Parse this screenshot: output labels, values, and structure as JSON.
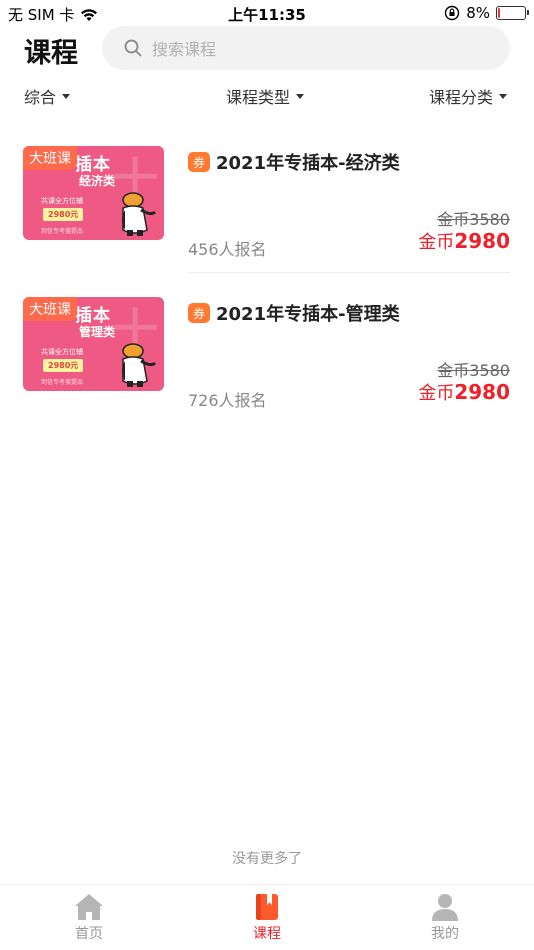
{
  "status_bar": {
    "carrier": "无 SIM 卡",
    "time": "上午11:35",
    "battery_percent": "8%",
    "battery_level": 0.08
  },
  "header": {
    "title": "课程",
    "search_placeholder": "搜索课程"
  },
  "filters": [
    {
      "label": "综合"
    },
    {
      "label": "课程类型"
    },
    {
      "label": "课程分类"
    }
  ],
  "courses": [
    {
      "tag": "大班课",
      "thumb_title": "插本",
      "thumb_subtitle": "经济类",
      "thumb_line1": "共课全方位辅",
      "thumb_price": "2980元",
      "thumb_line2": "到信专考搜提品",
      "coupon": "券",
      "title": "2021年专插本-经济类",
      "enrolled": "456人报名",
      "original_price": "金币3580",
      "price_currency": "金币",
      "price_value": "2980"
    },
    {
      "tag": "大班课",
      "thumb_title": "插本",
      "thumb_subtitle": "管理类",
      "thumb_line1": "共课全方位辅",
      "thumb_price": "2980元",
      "thumb_line2": "到信专考搜提品",
      "coupon": "券",
      "title": "2021年专插本-管理类",
      "enrolled": "726人报名",
      "original_price": "金币3580",
      "price_currency": "金币",
      "price_value": "2980"
    }
  ],
  "footer_note": "没有更多了",
  "tabs": [
    {
      "label": "首页",
      "icon": "home-icon",
      "active": false
    },
    {
      "label": "课程",
      "icon": "book-icon",
      "active": true
    },
    {
      "label": "我的",
      "icon": "user-icon",
      "active": false
    }
  ],
  "colors": {
    "accent": "#f0212b",
    "coupon": "#ff7a2f",
    "thumb_bg": "#ee5a83",
    "tag_bg": "#ff6a4d"
  }
}
